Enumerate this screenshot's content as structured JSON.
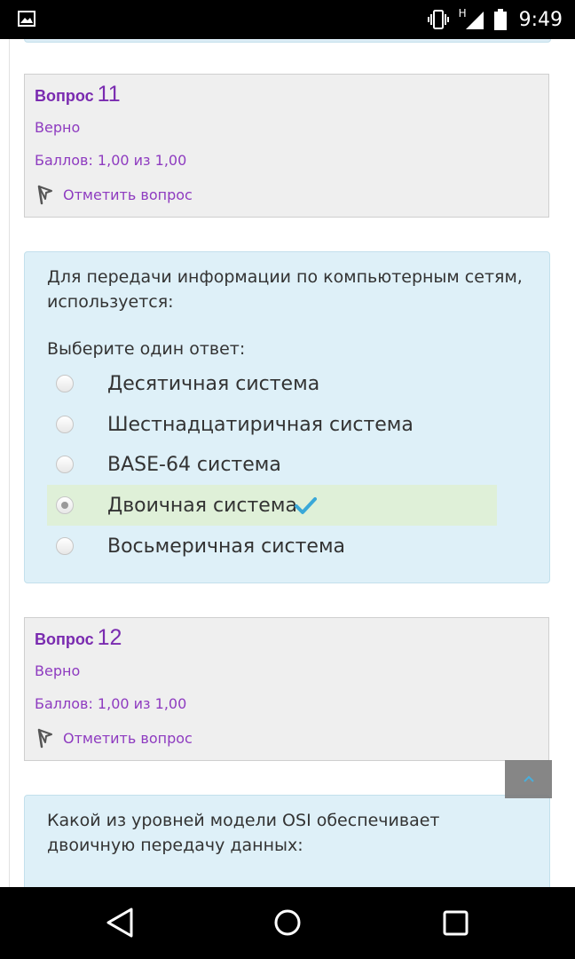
{
  "status_bar": {
    "time": "9:49",
    "signal_letter": "H",
    "icons": [
      "image-icon",
      "vibrate-icon",
      "signal-icon",
      "battery-icon"
    ]
  },
  "question_11": {
    "label": "Вопрос",
    "number": "11",
    "state": "Верно",
    "grade": "Баллов: 1,00 из 1,00",
    "flag_label": "Отметить вопрос",
    "text": "Для передачи информации по компьютерным сетям, используется:",
    "prompt": "Выберите один ответ:",
    "options": [
      {
        "label": "Десятичная система",
        "selected": false,
        "correct": false
      },
      {
        "label": "Шестнадцатиричная система",
        "selected": false,
        "correct": false
      },
      {
        "label": "BASE-64 система",
        "selected": false,
        "correct": false
      },
      {
        "label": "Двоичная система",
        "selected": true,
        "correct": true
      },
      {
        "label": "Восьмеричная система",
        "selected": false,
        "correct": false
      }
    ]
  },
  "question_12": {
    "label": "Вопрос",
    "number": "12",
    "state": "Верно",
    "grade": "Баллов: 1,00 из 1,00",
    "flag_label": "Отметить вопрос",
    "text": "Какой из уровней модели OSI обеспечивает двоичную передачу данных:"
  },
  "colors": {
    "accent_purple": "#8e3bc0",
    "info_bg": "#efefef",
    "question_bg": "#def0f8",
    "correct_bg": "#dff0d8",
    "check": "#3aa8d8"
  },
  "nav_bar": {
    "icons": [
      "back-icon",
      "home-icon",
      "recents-icon"
    ]
  }
}
